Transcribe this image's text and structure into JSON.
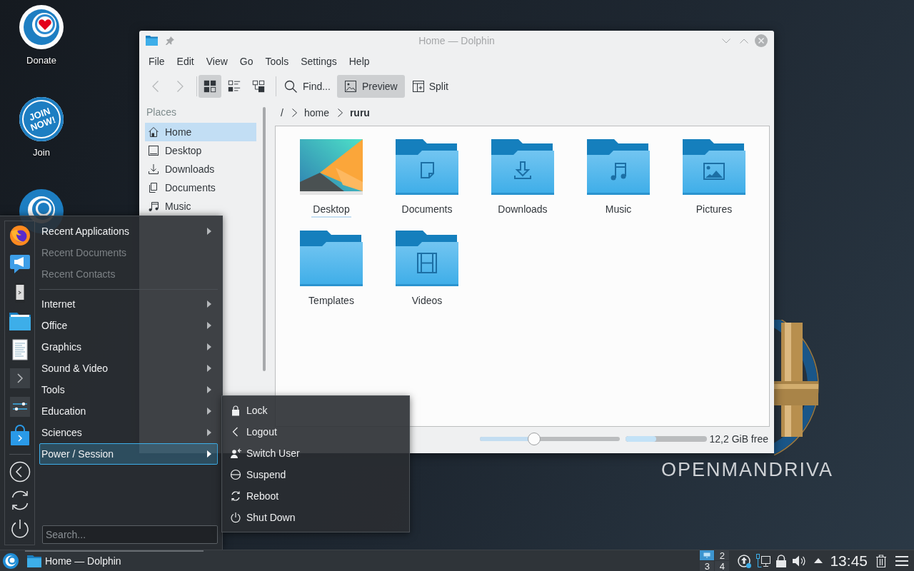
{
  "desktop": {
    "icons": [
      {
        "kind": "donate",
        "label": "Donate"
      },
      {
        "kind": "join",
        "label": "Join",
        "badge": "JOIN NOW!"
      },
      {
        "kind": "welcome"
      }
    ],
    "wordmark": "OPENMANDRIVA"
  },
  "window": {
    "title": "Home — Dolphin",
    "menubar": [
      "File",
      "Edit",
      "View",
      "Go",
      "Tools",
      "Settings",
      "Help"
    ],
    "toolbar": {
      "nav": [
        {
          "kind": "back",
          "disabled": true
        },
        {
          "kind": "forward",
          "disabled": true
        }
      ],
      "view_modes": [
        {
          "kind": "icons",
          "selected": true
        },
        {
          "kind": "details",
          "selected": false
        },
        {
          "kind": "compact",
          "selected": false
        }
      ],
      "buttons": [
        {
          "kind": "find",
          "label": "Find...",
          "selected": false
        },
        {
          "kind": "preview",
          "label": "Preview",
          "selected": true
        },
        {
          "kind": "split",
          "label": "Split",
          "selected": false
        }
      ]
    },
    "places": {
      "sections": [
        {
          "title": "Places",
          "items": [
            {
              "kind": "home",
              "label": "Home",
              "selected": true
            },
            {
              "kind": "desktop",
              "label": "Desktop",
              "selected": false
            },
            {
              "kind": "downloads",
              "label": "Downloads",
              "selected": false
            },
            {
              "kind": "documents",
              "label": "Documents",
              "selected": false
            },
            {
              "kind": "music",
              "label": "Music",
              "selected": false
            }
          ]
        }
      ]
    },
    "location": {
      "root": "/",
      "segments": [
        {
          "label": "home",
          "current": false
        },
        {
          "label": "ruru",
          "current": true
        }
      ]
    },
    "view": {
      "items": [
        {
          "kind": "thumbnail",
          "label": "Desktop",
          "focused": true
        },
        {
          "kind": "documents",
          "label": "Documents",
          "focused": false
        },
        {
          "kind": "downloads",
          "label": "Downloads",
          "focused": false
        },
        {
          "kind": "music",
          "label": "Music",
          "focused": false
        },
        {
          "kind": "pictures",
          "label": "Pictures",
          "focused": false
        },
        {
          "kind": "plain",
          "label": "Templates",
          "focused": false
        },
        {
          "kind": "videos",
          "label": "Videos",
          "focused": false
        }
      ]
    },
    "status_bar": {
      "zoom": {
        "level": 0.39
      },
      "disk": {
        "level": 0.38,
        "reading": "12,2 GiB free"
      }
    }
  },
  "launcher_menu": {
    "categories": [
      {
        "kind": "entry",
        "label": "Recent Applications",
        "disabled": false,
        "selected": false,
        "submenu": true
      },
      {
        "kind": "entry",
        "label": "Recent Documents",
        "disabled": true,
        "selected": false,
        "submenu": false
      },
      {
        "kind": "entry",
        "label": "Recent Contacts",
        "disabled": true,
        "selected": false,
        "submenu": false
      },
      {
        "kind": "separator"
      },
      {
        "kind": "entry",
        "label": "Internet",
        "disabled": false,
        "selected": false,
        "submenu": true
      },
      {
        "kind": "entry",
        "label": "Office",
        "disabled": false,
        "selected": false,
        "submenu": true
      },
      {
        "kind": "entry",
        "label": "Graphics",
        "disabled": false,
        "selected": false,
        "submenu": true
      },
      {
        "kind": "entry",
        "label": "Sound & Video",
        "disabled": false,
        "selected": false,
        "submenu": true
      },
      {
        "kind": "entry",
        "label": "Tools",
        "disabled": false,
        "selected": false,
        "submenu": true
      },
      {
        "kind": "entry",
        "label": "Education",
        "disabled": false,
        "selected": false,
        "submenu": true
      },
      {
        "kind": "entry",
        "label": "Sciences",
        "disabled": false,
        "selected": false,
        "submenu": true
      },
      {
        "kind": "entry",
        "label": "Power / Session",
        "disabled": false,
        "selected": true,
        "submenu": true
      }
    ],
    "search": {
      "placeholder": "Search..."
    }
  },
  "power_menu": {
    "items": [
      {
        "kind": "lock",
        "label": "Lock"
      },
      {
        "kind": "logout",
        "label": "Logout"
      },
      {
        "kind": "switch_user",
        "label": "Switch User"
      },
      {
        "kind": "suspend",
        "label": "Suspend"
      },
      {
        "kind": "reboot",
        "label": "Reboot"
      },
      {
        "kind": "shutdown",
        "label": "Shut Down"
      }
    ]
  },
  "taskbar": {
    "tasks": [
      {
        "label": "Home — Dolphin"
      }
    ],
    "pager": [
      {
        "selected": true,
        "has_window": true
      },
      {
        "label": "2",
        "selected": false,
        "has_window": false
      },
      {
        "label": "3",
        "selected": false,
        "has_window": false
      },
      {
        "label": "4",
        "selected": false,
        "has_window": false
      }
    ],
    "clock": "13:45"
  }
}
